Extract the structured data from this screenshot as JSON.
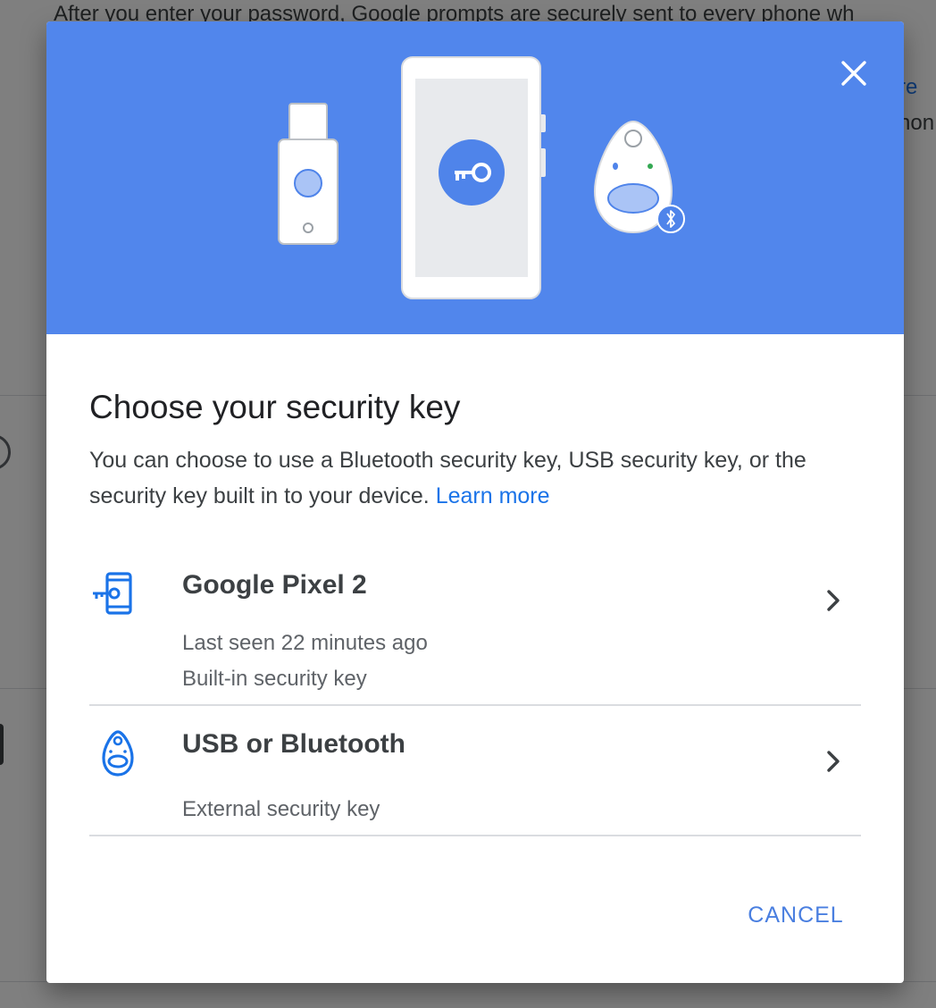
{
  "background": {
    "top_text": "After you enter your password, Google prompts are securely sent to every phone wh",
    "right_text_1": "re",
    "right_text_2": "hon"
  },
  "dialog": {
    "title": "Choose your security key",
    "description": "You can choose to use a Bluetooth security key, USB security key, or the security key built in to your device.",
    "learn_more": "Learn more",
    "options": [
      {
        "title": "Google Pixel 2",
        "line1": "Last seen 22 minutes ago",
        "line2": "Built-in security key",
        "icon": "phone-key-icon"
      },
      {
        "title": "USB or Bluetooth",
        "line1": "External security key",
        "icon": "security-key-fob-icon"
      }
    ],
    "cancel_label": "CANCEL"
  },
  "colors": {
    "hero_background": "#5186ec",
    "accent": "#1a73e8",
    "scrim": "rgba(0,0,0,0.5)"
  }
}
